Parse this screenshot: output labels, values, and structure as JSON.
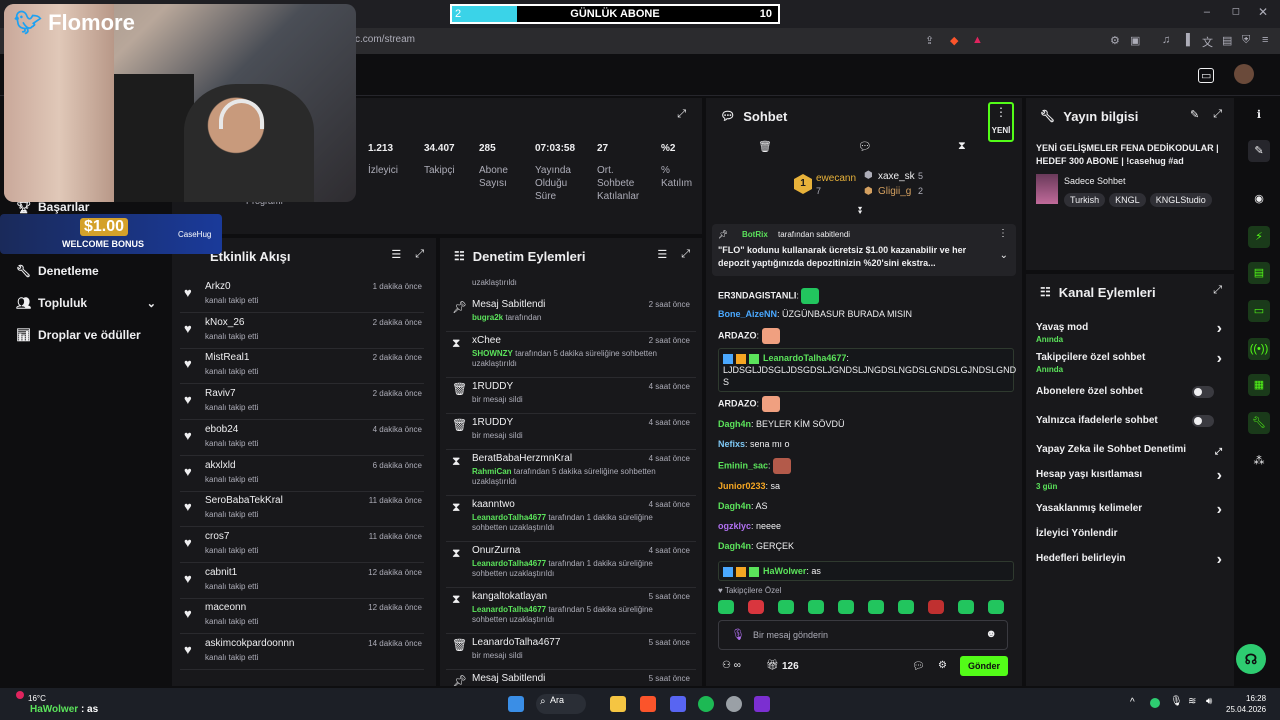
{
  "browser": {
    "url": "c.com/stream"
  },
  "goal": {
    "start": "2",
    "title": "GÜNLÜK ABONE",
    "target": "10",
    "progress": 0.2
  },
  "webcam": {
    "brand": "Flomore"
  },
  "promo": {
    "amount": "$1.00",
    "text": "WELCOME BONUS",
    "brand": "CaseHug"
  },
  "nav": {
    "items": [
      {
        "label": "Başarılar",
        "icon": "trophy-icon"
      },
      {
        "label": "Denetleme",
        "icon": "wrench-icon"
      },
      {
        "label": "Topluluk",
        "icon": "people-icon"
      },
      {
        "label": "Droplar ve ödüller",
        "icon": "chart-icon"
      }
    ],
    "partial_label": "Programı"
  },
  "stats": [
    {
      "value": "1.213",
      "label": "İzleyici"
    },
    {
      "value": "34.407",
      "label": "Takipçi"
    },
    {
      "value": "285",
      "label": "Abone Sayısı"
    },
    {
      "value": "07:03:58",
      "label": "Yayında Olduğu Süre"
    },
    {
      "value": "27",
      "label": "Ort. Sohbete Katılanlar"
    },
    {
      "value": "%2",
      "label": "% Katılım"
    }
  ],
  "activity": {
    "title": "Etkinlik Akışı",
    "items": [
      {
        "name": "Arkz0",
        "sub": "kanalı takip etti",
        "time": "1 dakika önce"
      },
      {
        "name": "kNox_26",
        "sub": "kanalı takip etti",
        "time": "2 dakika önce"
      },
      {
        "name": "MistReal1",
        "sub": "kanalı takip etti",
        "time": "2 dakika önce"
      },
      {
        "name": "Raviv7",
        "sub": "kanalı takip etti",
        "time": "2 dakika önce"
      },
      {
        "name": "ebob24",
        "sub": "kanalı takip etti",
        "time": "4 dakika önce"
      },
      {
        "name": "akxlxld",
        "sub": "kanalı takip etti",
        "time": "6 dakika önce"
      },
      {
        "name": "SeroBabaTekKral",
        "sub": "kanalı takip etti",
        "time": "11 dakika önce"
      },
      {
        "name": "cros7",
        "sub": "kanalı takip etti",
        "time": "11 dakika önce"
      },
      {
        "name": "cabnit1",
        "sub": "kanalı takip etti",
        "time": "12 dakika önce"
      },
      {
        "name": "maceonn",
        "sub": "kanalı takip etti",
        "time": "12 dakika önce"
      },
      {
        "name": "askimcokpardoonnn",
        "sub": "kanalı takip etti",
        "time": "14 dakika önce"
      }
    ]
  },
  "moderation": {
    "title": "Denetim Eylemleri",
    "top_fragment": "uzaklaştırıldı",
    "items": [
      {
        "icon": "pin-icon",
        "name": "Mesaj Sabitlendi",
        "actor": "bugra2k",
        "rest": " tarafından",
        "time": "2 saat önce"
      },
      {
        "icon": "hourglass-icon",
        "name": "xChee",
        "actor": "SHOWNZY",
        "rest": " tarafından 5 dakika süreliğine sohbetten uzaklaştırıldı",
        "time": "2 saat önce"
      },
      {
        "icon": "trash-icon",
        "name": "1RUDDY",
        "actor": "",
        "rest": "bir mesajı sildi",
        "time": "4 saat önce"
      },
      {
        "icon": "trash-icon",
        "name": "1RUDDY",
        "actor": "",
        "rest": "bir mesajı sildi",
        "time": "4 saat önce"
      },
      {
        "icon": "hourglass-icon",
        "name": "BeratBabaHerzmnKral",
        "actor": "RahmiCan",
        "rest": " tarafından 5 dakika süreliğine sohbetten uzaklaştırıldı",
        "time": "4 saat önce"
      },
      {
        "icon": "hourglass-icon",
        "name": "kaanntwo",
        "actor": "LeanardoTalha4677",
        "rest": " tarafından 1 dakika süreliğine sohbetten uzaklaştırıldı",
        "time": "4 saat önce"
      },
      {
        "icon": "hourglass-icon",
        "name": "OnurZurna",
        "actor": "LeanardoTalha4677",
        "rest": " tarafından 1 dakika süreliğine sohbetten uzaklaştırıldı",
        "time": "4 saat önce"
      },
      {
        "icon": "hourglass-icon",
        "name": "kangaltokatlayan",
        "actor": "LeanardoTalha4677",
        "rest": " tarafından 5 dakika süreliğine sohbetten uzaklaştırıldı",
        "time": "5 saat önce"
      },
      {
        "icon": "trash-icon",
        "name": "LeanardoTalha4677",
        "actor": "",
        "rest": "bir mesajı sildi",
        "time": "5 saat önce"
      },
      {
        "icon": "pin-icon",
        "name": "Mesaj Sabitlendi",
        "actor": "",
        "rest": "",
        "time": "5 saat önce"
      }
    ]
  },
  "chat": {
    "title": "Sohbet",
    "new_label": "YENİ",
    "leaders": [
      {
        "rank": "1",
        "name": "ewecann",
        "count": "7"
      },
      {
        "name": "xaxe_sk",
        "count": "5"
      },
      {
        "name": "Gligii_g",
        "count": "2"
      }
    ],
    "pinned": {
      "author": "BotRix",
      "suffix": "tarafından sabitlendi",
      "text": "\"FLO\" kodunu kullanarak ücretsiz $1.00 kazanabilir ve her depozit yaptığınızda depozitinizin %20'sini ekstra..."
    },
    "messages": [
      {
        "user": "ER3NDAGISTANLI",
        "color": "#efeff1",
        "text": "",
        "emote": "#22c55e"
      },
      {
        "user": "Bone_AizeNN",
        "color": "#4aa8ff",
        "text": "ÜZGÜNBASUR BURADA MISIN",
        "emote": ""
      },
      {
        "user": "ARDAZO",
        "color": "#efeff1",
        "text": "",
        "emote": "#f0a080"
      },
      {
        "user": "LeanardoTalha4677",
        "color": "#5be35b",
        "text": "LJDSGLJDSGLJDSGDSLJGNDSLJNGDSLNGDSLGNDSLGJNDSLGND S",
        "emote": ""
      },
      {
        "user": "ARDAZO",
        "color": "#efeff1",
        "text": "",
        "emote": "#f0a080"
      },
      {
        "user": "Dagh4n",
        "color": "#5be35b",
        "text": "BEYLER KİM SÖVDÜ",
        "emote": ""
      },
      {
        "user": "Nefixs",
        "color": "#7ec8f5",
        "text": "sena mı o",
        "emote": ""
      },
      {
        "user": "Eminin_sac",
        "color": "#5be35b",
        "text": "",
        "emote": "#b35a4a"
      },
      {
        "user": "Junior0233",
        "color": "#f5a623",
        "text": "sa",
        "emote": ""
      },
      {
        "user": "Dagh4n",
        "color": "#5be35b",
        "text": "AS",
        "emote": ""
      },
      {
        "user": "ogzklyc",
        "color": "#b070f0",
        "text": "neeee",
        "emote": ""
      },
      {
        "user": "Dagh4n",
        "color": "#5be35b",
        "text": "GERÇEK",
        "emote": ""
      },
      {
        "user": "HaWolwer",
        "color": "#5be35b",
        "text": "as",
        "emote": ""
      }
    ],
    "followers_only": "Takipçilere Özel",
    "input_placeholder": "Bir mesaj gönderin",
    "points": "126",
    "send_label": "Gönder"
  },
  "info": {
    "title": "Yayın bilgisi",
    "stream_title": "YENİ GELİŞMELER FENA DEDİKODULAR | HEDEF 300 ABONE | !casehug #ad",
    "category": "Sadece Sohbet",
    "tags": [
      "Turkish",
      "KNGL",
      "KNGLStudio"
    ]
  },
  "actions": {
    "title": "Kanal Eylemleri",
    "items": [
      {
        "label": "Yavaş mod",
        "sub": "Anında",
        "control": "chevron"
      },
      {
        "label": "Takipçilere özel sohbet",
        "sub": "Anında",
        "control": "chevron"
      },
      {
        "label": "Abonelere özel sohbet",
        "sub": "",
        "control": "toggle"
      },
      {
        "label": "Yalnızca ifadelerle sohbet",
        "sub": "",
        "control": "toggle"
      },
      {
        "label": "Yapay Zeka ile Sohbet Denetimi",
        "sub": "",
        "control": "external"
      },
      {
        "label": "Hesap yaşı kısıtlaması",
        "sub": "3 gün",
        "control": "chevron"
      },
      {
        "label": "Yasaklanmış kelimeler",
        "sub": "",
        "control": "chevron"
      },
      {
        "label": "İzleyici Yönlendir",
        "sub": "",
        "control": ""
      },
      {
        "label": "Hedefleri belirleyin",
        "sub": "",
        "control": "chevron"
      }
    ]
  },
  "taskbar": {
    "temp": "16°C",
    "chat_user": "HaWolwer",
    "chat_text": ": as",
    "search": "Ara",
    "time": "16:28",
    "date": "25.04.2026"
  },
  "colors": {
    "accent": "#53fc18",
    "bg": "#0e0e10",
    "panel": "#18181b"
  }
}
